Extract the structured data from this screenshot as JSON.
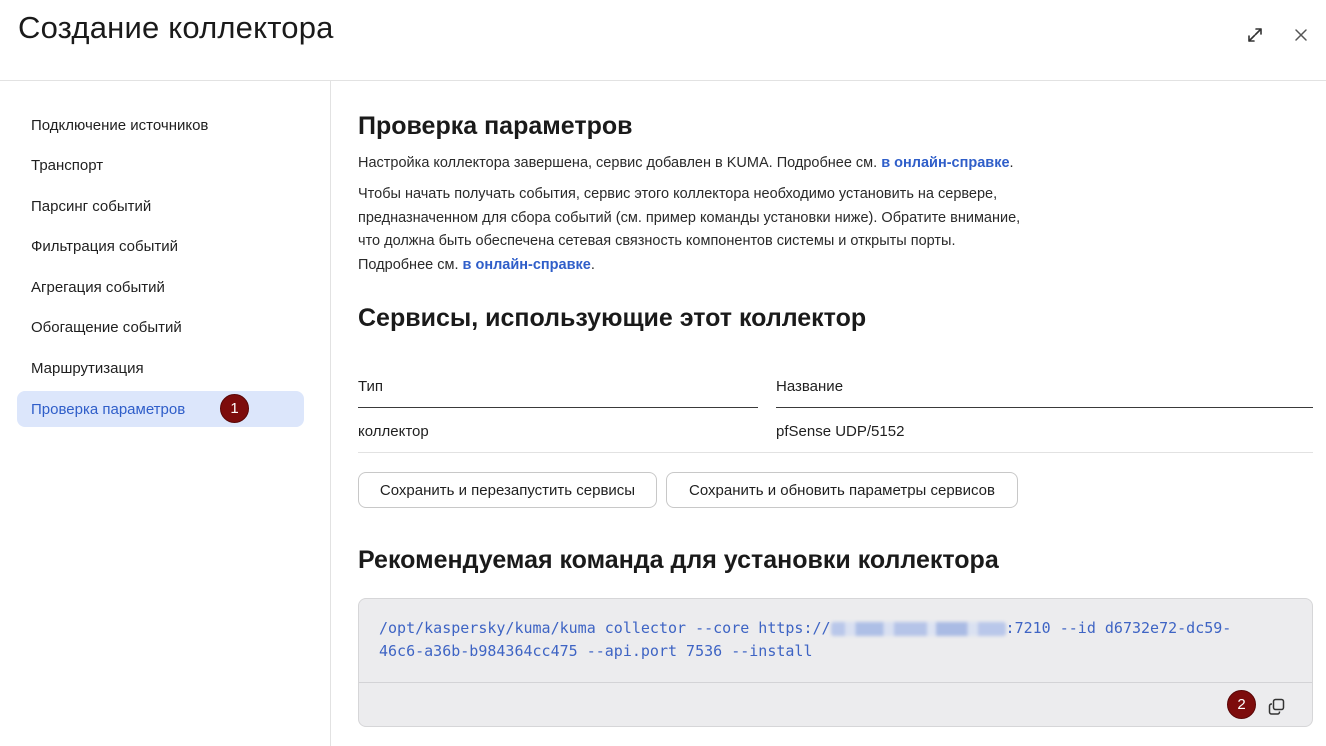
{
  "window": {
    "title": "Создание коллектора",
    "expand_icon": "expand-icon",
    "close_icon": "close-icon"
  },
  "sidebar": {
    "items": [
      {
        "label": "Подключение источников",
        "active": false
      },
      {
        "label": "Транспорт",
        "active": false
      },
      {
        "label": "Парсинг событий",
        "active": false
      },
      {
        "label": "Фильтрация событий",
        "active": false
      },
      {
        "label": "Агрегация событий",
        "active": false
      },
      {
        "label": "Обогащение событий",
        "active": false
      },
      {
        "label": "Маршрутизация",
        "active": false
      },
      {
        "label": "Проверка параметров",
        "active": true
      }
    ],
    "active_color": "#dce6fb"
  },
  "annotations": {
    "badge_1": "1",
    "badge_2": "2",
    "badge_color": "#7d0c0c"
  },
  "main": {
    "section1": {
      "heading": "Проверка параметров",
      "para1_text": "Настройка коллектора завершена, сервис добавлен в KUMA. Подробнее см. ",
      "para1_link": "в онлайн-справке",
      "para1_end": ".",
      "para2_line1": "Чтобы начать получать события, сервис этого коллектора необходимо установить на сервере,",
      "para2_line2": "предназначенном для сбора событий (см. пример команды установки ниже). Обратите внимание,",
      "para2_line3": "что должна быть обеспечена сетевая связность компонентов системы и открыты порты.",
      "para2_line4": "Подробнее см. ",
      "para2_link": "в онлайн-справке",
      "para2_end": "."
    },
    "section2": {
      "heading": "Сервисы, использующие этот коллектор",
      "table": {
        "columns": [
          "Тип",
          "Название"
        ],
        "rows": [
          [
            "коллектор",
            "pfSense UDP/5152"
          ]
        ]
      },
      "buttons": {
        "restart": "Сохранить и перезапустить сервисы",
        "update": "Сохранить и обновить параметры сервисов"
      }
    },
    "section3": {
      "heading": "Рекомендуемая команда для установки коллектора",
      "command_part1": "/opt/kaspersky/kuma/kuma collector --core https://",
      "command_part2": ":7210 --id d6732e72-dc59-",
      "command_line2": "46c6-a36b-b984364cc475 --api.port 7536 --install",
      "copy_icon": "copy-icon"
    },
    "link_color": "#2f5ec9"
  }
}
